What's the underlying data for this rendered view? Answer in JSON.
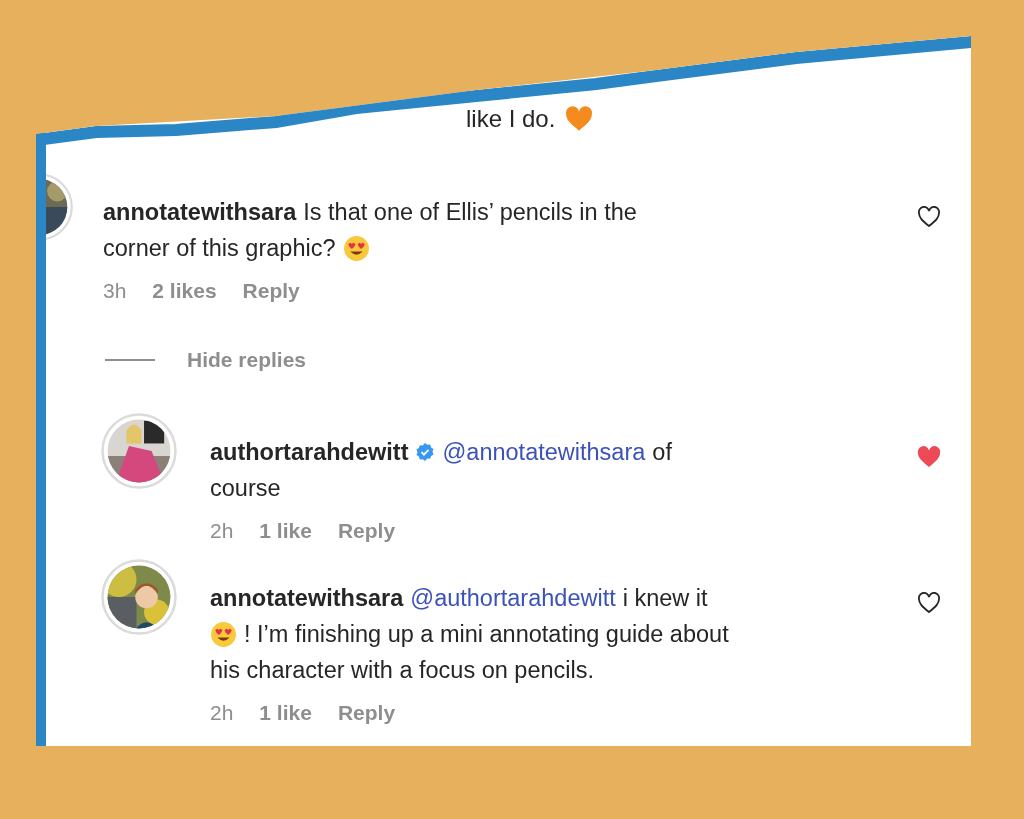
{
  "fragment": {
    "text": "like I do."
  },
  "comments": [
    {
      "username": "annotatewithsara",
      "verified": false,
      "avatar": {
        "kind": "picture"
      },
      "lines": [
        [
          {
            "kind": "text",
            "text": "Is that one of Ellis’ pencils in the"
          }
        ],
        [
          {
            "kind": "text",
            "text": "corner of this graphic?"
          },
          {
            "kind": "emoji"
          }
        ]
      ],
      "time": "3h",
      "likes": "2 likes",
      "reply": "Reply",
      "liked": false
    }
  ],
  "hide_replies": "Hide replies",
  "replies": [
    {
      "username": "authortarahdewitt",
      "verified": true,
      "avatar": {
        "kind": "picture"
      },
      "lines": [
        [
          {
            "kind": "mention",
            "text": "@annotatewithsara"
          },
          {
            "kind": "text",
            "text": "of"
          }
        ],
        [
          {
            "kind": "text",
            "text": "course"
          }
        ]
      ],
      "time": "2h",
      "likes": "1 like",
      "reply": "Reply",
      "liked": true
    },
    {
      "username": "annotatewithsara",
      "verified": false,
      "avatar": {
        "kind": "picture"
      },
      "lines": [
        [
          {
            "kind": "mention",
            "text": "@authortarahdewitt"
          },
          {
            "kind": "text",
            "text": "i knew it"
          }
        ],
        [
          {
            "kind": "emoji"
          },
          {
            "kind": "text",
            "text": "! I’m finishing up a mini annotating guide about"
          }
        ],
        [
          {
            "kind": "text",
            "text": "his character with a focus on pencils."
          }
        ]
      ],
      "time": "2h",
      "likes": "1 like",
      "reply": "Reply",
      "liked": false
    }
  ]
}
